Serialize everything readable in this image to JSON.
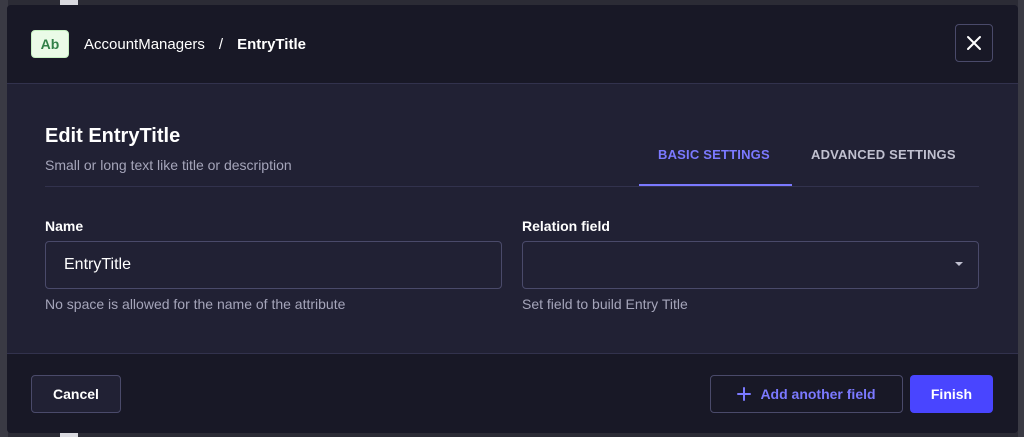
{
  "header": {
    "type_badge": "Ab",
    "breadcrumb": [
      "AccountManagers",
      "EntryTitle"
    ],
    "separator": "/"
  },
  "main": {
    "title": "Edit EntryTitle",
    "subtitle": "Small or long text like title or description",
    "tabs": [
      {
        "label": "BASIC SETTINGS",
        "active": true
      },
      {
        "label": "ADVANCED SETTINGS",
        "active": false
      }
    ]
  },
  "fields": {
    "name": {
      "label": "Name",
      "value": "EntryTitle",
      "hint": "No space is allowed for the name of the attribute"
    },
    "relation": {
      "label": "Relation field",
      "value": "",
      "hint": "Set field to build Entry Title"
    }
  },
  "footer": {
    "cancel_label": "Cancel",
    "add_label": "Add another field",
    "finish_label": "Finish"
  },
  "icons": {
    "close": "close-icon",
    "plus": "plus-icon",
    "caret": "caret-down-icon"
  },
  "colors": {
    "primary": "#4945ff",
    "primary_text": "#7b79ff",
    "badge_bg": "#eafbe7",
    "badge_text": "#328048"
  }
}
